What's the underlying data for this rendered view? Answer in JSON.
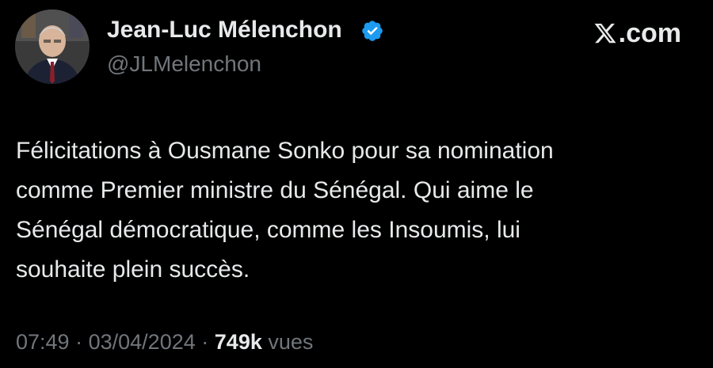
{
  "author": {
    "name": "Jean-Luc Mélenchon",
    "handle": "@JLMelenchon",
    "verified": true,
    "avatar_icon": "profile-photo"
  },
  "site": {
    "label": ".com",
    "logo_icon": "x-logo-icon"
  },
  "tweet": {
    "text_lines": [
      "Félicitations à Ousmane Sonko pour sa nomination",
      "comme Premier ministre du Sénégal. Qui aime le",
      "Sénégal démocratique, comme les Insoumis, lui",
      "souhaite plein succès."
    ]
  },
  "meta": {
    "time": "07:49",
    "separator": "·",
    "date": "03/04/2024",
    "views_count": "749k",
    "views_label": "vues"
  },
  "colors": {
    "background": "#000000",
    "primary_text": "#e7e9ea",
    "secondary_text": "#71767b",
    "verified_blue": "#1d9bf0"
  }
}
